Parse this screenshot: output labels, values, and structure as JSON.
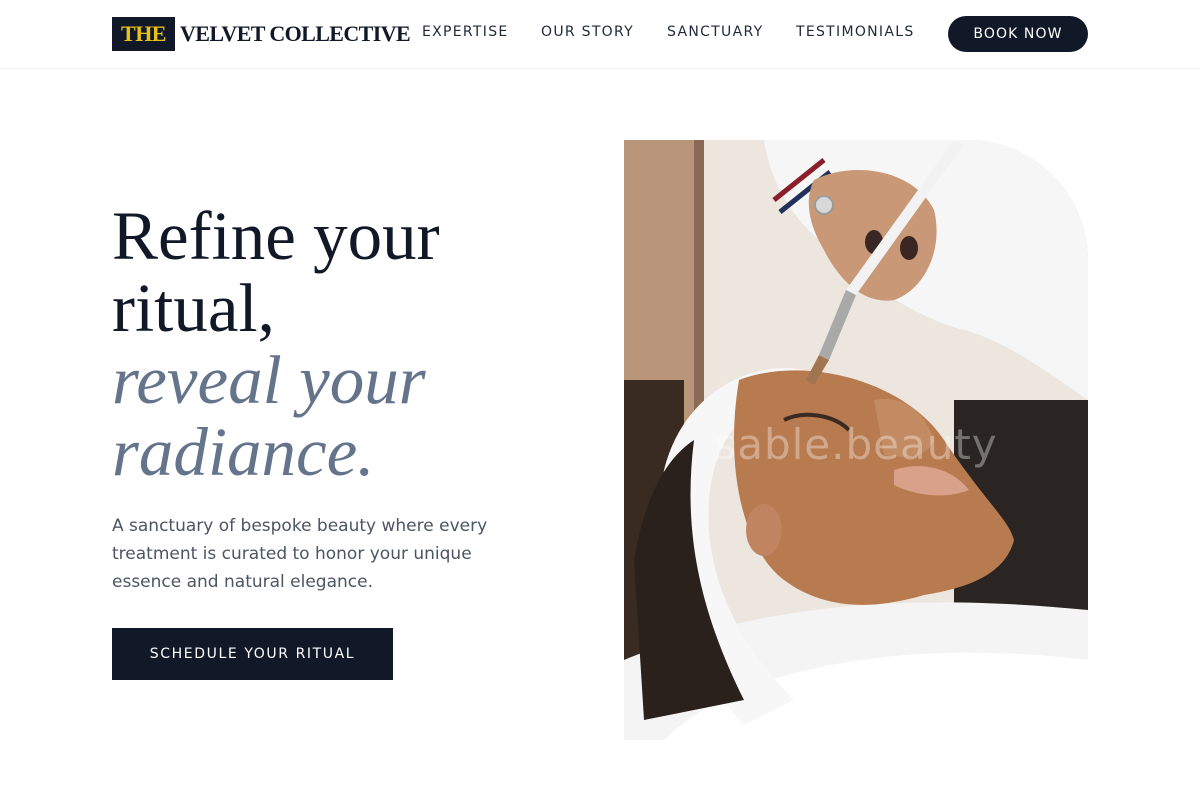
{
  "header": {
    "logo_mark": "THE",
    "logo_text": "VELVET COLLECTIVE",
    "nav": [
      "EXPERTISE",
      "OUR STORY",
      "SANCTUARY",
      "TESTIMONIALS"
    ],
    "book_label": "BOOK NOW"
  },
  "hero": {
    "headline_line1": "Refine your",
    "headline_line2": "ritual,",
    "headline_accent1": "reveal your",
    "headline_accent2": "radiance.",
    "subtext": "A sanctuary of bespoke beauty where every treatment is curated to honor your unique essence and natural elegance.",
    "cta_label": "SCHEDULE YOUR RITUAL"
  },
  "image": {
    "watermark": "sable.beauty",
    "subject": "facial-mask-treatment-photo"
  },
  "colors": {
    "primary": "#111827",
    "accent_gold": "#e8c21a",
    "muted_slate": "#64748b",
    "body_text": "#4b5563"
  }
}
